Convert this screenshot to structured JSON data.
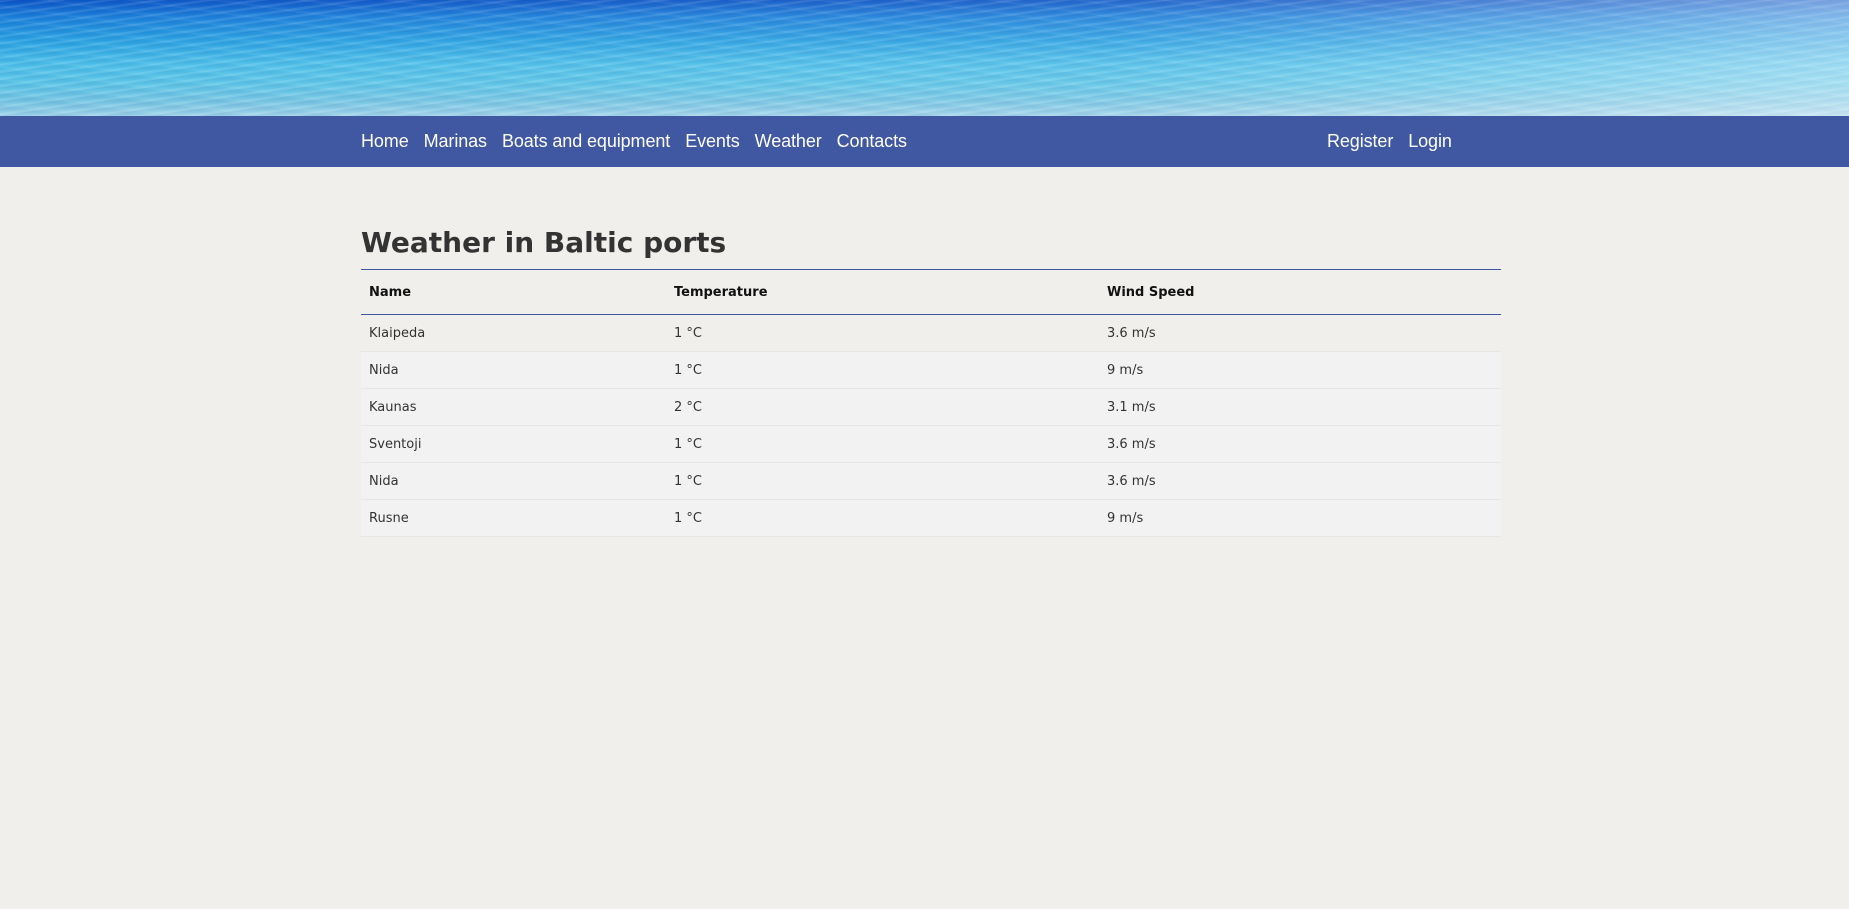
{
  "nav": {
    "left": [
      "Home",
      "Marinas",
      "Boats and equipment",
      "Events",
      "Weather",
      "Contacts"
    ],
    "right": [
      "Register",
      "Login"
    ]
  },
  "page": {
    "title": "Weather in Baltic ports"
  },
  "table": {
    "headers": [
      "Name",
      "Temperature",
      "Wind Speed"
    ],
    "rows": [
      [
        "Klaipeda",
        "1 °C",
        "3.6 m/s"
      ],
      [
        "Nida",
        "1 °C",
        "9 m/s"
      ],
      [
        "Kaunas",
        "2 °C",
        "3.1 m/s"
      ],
      [
        "Sventoji",
        "1 °C",
        "3.6 m/s"
      ],
      [
        "Nida",
        "1 °C",
        "3.6 m/s"
      ],
      [
        "Rusne",
        "1 °C",
        "9 m/s"
      ]
    ]
  },
  "colors": {
    "navbar": "#4057a2",
    "background": "#f0efeb",
    "title": "#333333"
  }
}
